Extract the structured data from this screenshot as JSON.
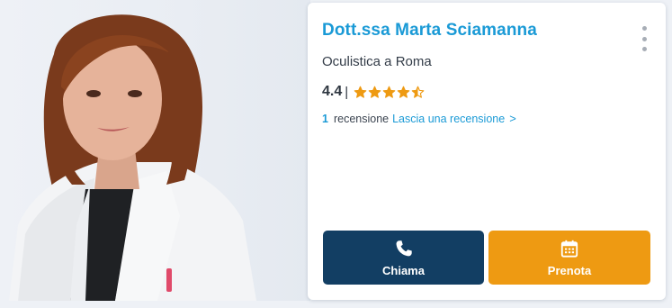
{
  "doctor": {
    "name": "Dott.ssa Marta Sciamanna",
    "specialty": "Oculistica a Roma"
  },
  "rating": {
    "value": "4.4",
    "separator": "|",
    "stars_max": 5,
    "stars_filled": 4.4,
    "star_color": "#ee9a12"
  },
  "reviews": {
    "count": "1",
    "word": "recensione",
    "link_label": "Lascia una recensione",
    "link_chevron": ">"
  },
  "actions": {
    "call_label": "Chiama",
    "book_label": "Prenota"
  },
  "icons": {
    "menu": "more-vertical-icon",
    "call": "phone-icon",
    "book": "calendar-icon"
  },
  "colors": {
    "brand_blue": "#1a9ad6",
    "call_button": "#123e63",
    "book_button": "#ee9a12"
  }
}
